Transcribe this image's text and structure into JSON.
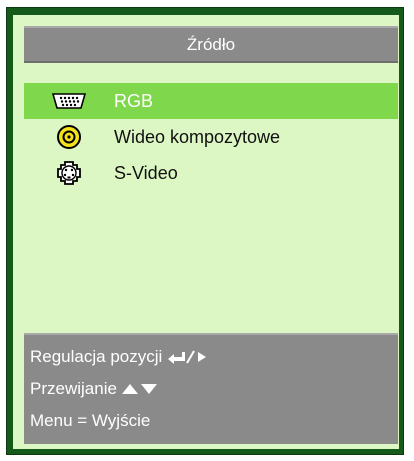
{
  "title": "Źródło",
  "items": [
    {
      "label": "RGB",
      "icon": "vga-port-icon",
      "selected": true
    },
    {
      "label": "Wideo kompozytowe",
      "icon": "composite-rca-icon",
      "selected": false
    },
    {
      "label": "S-Video",
      "icon": "s-video-port-icon",
      "selected": false
    }
  ],
  "footer": {
    "adjust_label": "Regulacja pozycji",
    "scroll_label": "Przewijanie",
    "menu_label": "Menu = Wyjście"
  },
  "colors": {
    "frame": "#145a1a",
    "background": "#dcf6c4",
    "selected": "#7fd84c",
    "bar": "#8a8a8a"
  }
}
